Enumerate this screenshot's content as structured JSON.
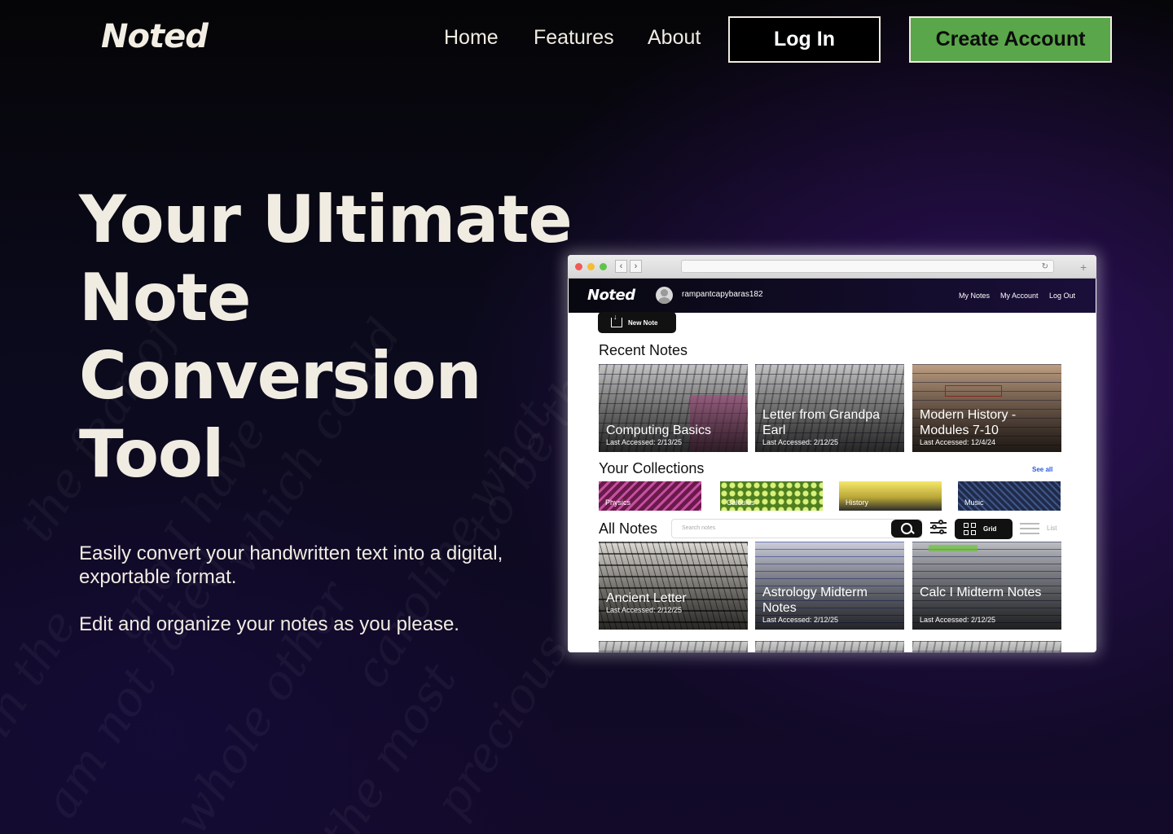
{
  "brand": {
    "logo": "Noted"
  },
  "nav": {
    "home": "Home",
    "features": "Features",
    "about": "About",
    "login": "Log In",
    "create_account": "Create Account"
  },
  "hero": {
    "title_lines": [
      "Your Ultimate",
      "Note",
      "Conversion",
      "Tool"
    ],
    "para1": "Easily convert your handwritten text into a digital, exportable format.",
    "para2": "Edit and organize your notes as you please."
  },
  "background_script": [
    "the fear of",
    "and I have",
    "which could",
    "caroline what",
    "to be there",
    "am not fated",
    "whole other",
    "the most",
    "precious",
    "in the"
  ],
  "mockup": {
    "app_logo": "Noted",
    "username": "rampantcapybaras182",
    "links": [
      "My Notes",
      "My Account",
      "Log Out"
    ],
    "new_note": "New Note",
    "recent_heading": "Recent Notes",
    "recent_notes": [
      {
        "title": "Computing Basics",
        "date": "Last Accessed: 2/13/25"
      },
      {
        "title": "Letter from Grandpa Earl",
        "date": "Last Accessed: 2/12/25"
      },
      {
        "title": "Modern History - Modules 7-10",
        "date": "Last Accessed: 12/4/24"
      }
    ],
    "collections_heading": "Your Collections",
    "see_all": "See all",
    "collections": [
      {
        "name": "Physics",
        "color": "#8a2a6a"
      },
      {
        "name": "Calculus",
        "color": "#8bc34a"
      },
      {
        "name": "History",
        "color": "#e7d94a"
      },
      {
        "name": "Music",
        "color": "#2c3e6a"
      }
    ],
    "all_heading": "All Notes",
    "search_placeholder": "Search notes",
    "grid_label": "Grid",
    "list_label": "List",
    "all_notes": [
      {
        "title": "Ancient Letter",
        "date": "Last Accessed: 2/12/25"
      },
      {
        "title": "Astrology Midterm Notes",
        "date": "Last Accessed: 2/12/25"
      },
      {
        "title": "Calc I Midterm Notes",
        "date": "Last Accessed: 2/12/25"
      }
    ]
  },
  "colors": {
    "accent_green": "#5aa64a",
    "text_cream": "#f1ece2",
    "bg_purple": "#1a0f3a"
  }
}
